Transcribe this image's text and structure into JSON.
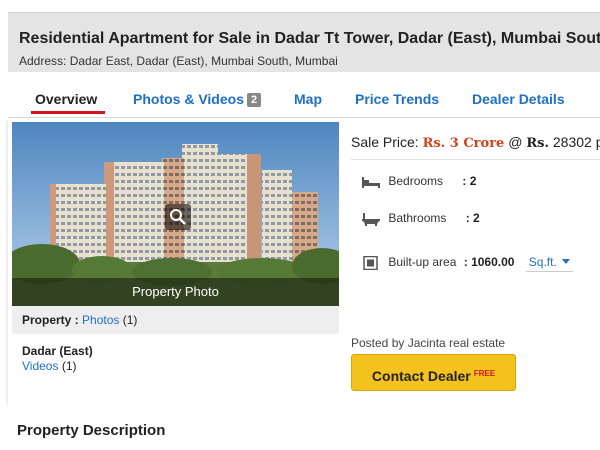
{
  "header": {
    "title": "Residential Apartment for Sale in Dadar Tt Tower, Dadar (East), Mumbai South",
    "address": "Address: Dadar East, Dadar (East), Mumbai South, Mumbai"
  },
  "tabs": [
    {
      "label": "Overview",
      "active": true
    },
    {
      "label": "Photos & Videos",
      "badge": "2"
    },
    {
      "label": "Map"
    },
    {
      "label": "Price Trends"
    },
    {
      "label": "Dealer Details"
    }
  ],
  "photo": {
    "caption": "Property Photo",
    "icon": "magnifier-icon"
  },
  "property_strip": {
    "label": "Property :",
    "link": "Photos",
    "count": "(1)"
  },
  "locality": {
    "name": "Dadar (East)",
    "videos_link": "Videos",
    "videos_count": "(1)"
  },
  "sale": {
    "label": "Sale Price:",
    "price": "Rs. 3 Crore",
    "at": "@",
    "rs": "Rs.",
    "rate": "28302",
    "per": "per"
  },
  "features": {
    "bedrooms": {
      "label": "Bedrooms",
      "value": ": 2",
      "icon": "bed-icon"
    },
    "bathrooms": {
      "label": "Bathrooms",
      "value": ": 2",
      "icon": "bathtub-icon"
    },
    "builtup": {
      "label": "Built-up area",
      "value": ": 1060.00",
      "unit": "Sq.ft.",
      "icon": "area-icon"
    }
  },
  "posted_by": "Posted by Jacinta real estate",
  "contact": {
    "label": "Contact Dealer",
    "badge": "FREE"
  },
  "description": {
    "heading": "Property Description"
  },
  "colors": {
    "link_blue": "#1f6fc5",
    "active_underline": "#d0161c",
    "price_orange": "#d0441c",
    "button_yellow": "#f4c21c"
  }
}
